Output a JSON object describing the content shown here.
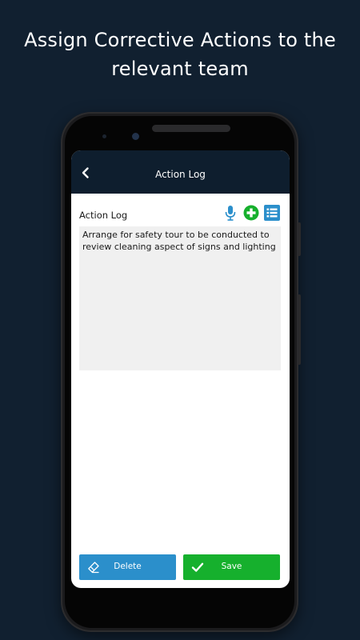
{
  "promo": {
    "line1": "Assign Corrective Actions to the",
    "line2": "relevant team"
  },
  "header": {
    "title": "Action Log",
    "back_icon": "chevron-left-icon"
  },
  "field": {
    "label": "Action Log",
    "value": "Arrange for safety tour to be conducted to review cleaning aspect of signs and lighting",
    "icons": [
      "microphone-icon",
      "plus-circle-icon",
      "list-icon"
    ]
  },
  "buttons": {
    "delete_label": "Delete",
    "save_label": "Save"
  },
  "colors": {
    "background": "#112030",
    "header": "#0e1e2e",
    "accent_blue": "#2b8fcb",
    "accent_green": "#16b02d",
    "text_area": "#f0f0f0"
  }
}
